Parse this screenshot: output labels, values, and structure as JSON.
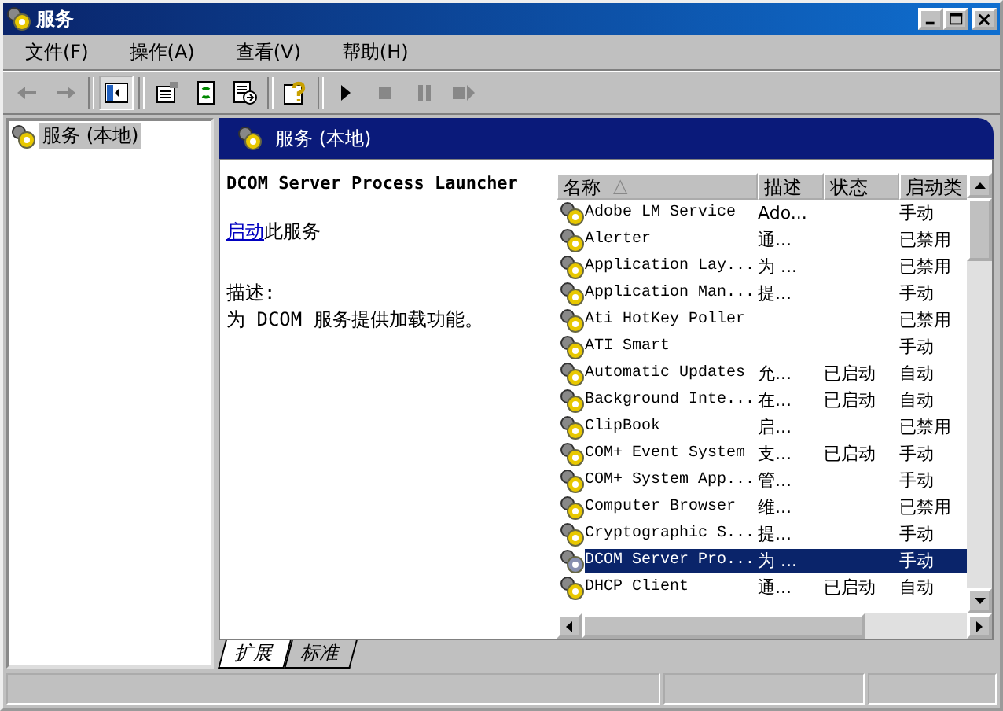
{
  "window": {
    "title": "服务"
  },
  "menu": [
    "文件(F)",
    "操作(A)",
    "查看(V)",
    "帮助(H)"
  ],
  "tree": [
    {
      "label": "服务 (本地)",
      "selected": true
    }
  ],
  "panel_header": "服务 (本地)",
  "details": {
    "title": "DCOM Server Process Launcher",
    "action_link": "启动",
    "action_rest": "此服务",
    "description_label": "描述:",
    "description": "为 DCOM 服务提供加载功能。"
  },
  "table": {
    "columns": [
      "名称",
      "描述",
      "状态",
      "启动类"
    ],
    "sort_mark": "△",
    "rows": [
      {
        "name": "Adobe LM Service",
        "description": "Ado...",
        "status": "",
        "startup": "手动",
        "selected": false
      },
      {
        "name": "Alerter",
        "description": "通...",
        "status": "",
        "startup": "已禁用",
        "selected": false
      },
      {
        "name": "Application Lay...",
        "description": "为 ...",
        "status": "",
        "startup": "已禁用",
        "selected": false
      },
      {
        "name": "Application Man...",
        "description": "提...",
        "status": "",
        "startup": "手动",
        "selected": false
      },
      {
        "name": "Ati HotKey Poller",
        "description": "",
        "status": "",
        "startup": "已禁用",
        "selected": false
      },
      {
        "name": "ATI Smart",
        "description": "",
        "status": "",
        "startup": "手动",
        "selected": false
      },
      {
        "name": "Automatic Updates",
        "description": "允...",
        "status": "已启动",
        "startup": "自动",
        "selected": false
      },
      {
        "name": "Background Inte...",
        "description": "在...",
        "status": "已启动",
        "startup": "自动",
        "selected": false
      },
      {
        "name": "ClipBook",
        "description": "启...",
        "status": "",
        "startup": "已禁用",
        "selected": false
      },
      {
        "name": "COM+ Event System",
        "description": "支...",
        "status": "已启动",
        "startup": "手动",
        "selected": false
      },
      {
        "name": "COM+ System App...",
        "description": "管...",
        "status": "",
        "startup": "手动",
        "selected": false
      },
      {
        "name": "Computer Browser",
        "description": "维...",
        "status": "",
        "startup": "已禁用",
        "selected": false
      },
      {
        "name": "Cryptographic S...",
        "description": "提...",
        "status": "",
        "startup": "手动",
        "selected": false
      },
      {
        "name": "DCOM Server Pro...",
        "description": "为 ...",
        "status": "",
        "startup": "手动",
        "selected": true
      },
      {
        "name": "DHCP Client",
        "description": "通...",
        "status": "已启动",
        "startup": "自动",
        "selected": false
      }
    ]
  },
  "view_tabs": [
    {
      "label": "扩展",
      "selected": true
    },
    {
      "label": "标准",
      "selected": false
    }
  ]
}
